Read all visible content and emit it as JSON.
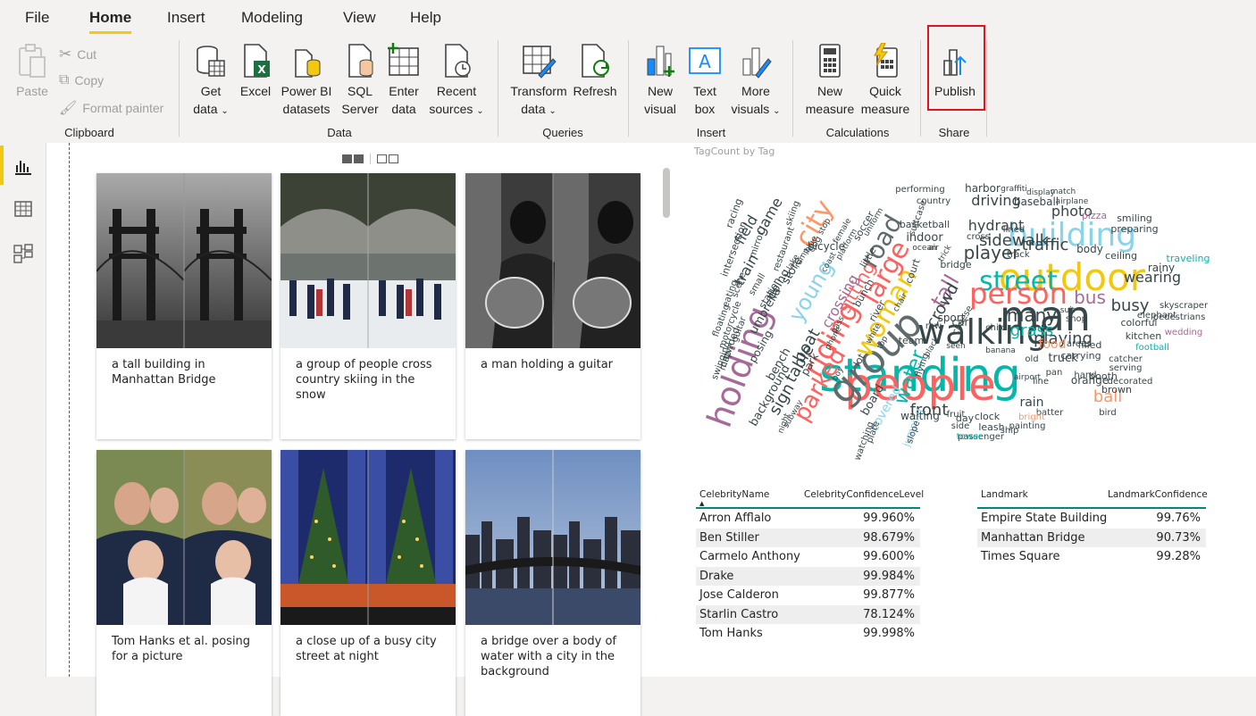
{
  "ribbon": {
    "tabs": [
      "File",
      "Home",
      "Insert",
      "Modeling",
      "View",
      "Help"
    ],
    "clipboard": {
      "paste": "Paste",
      "cut": "Cut",
      "copy": "Copy",
      "format_painter": "Format painter",
      "group": "Clipboard"
    },
    "data": {
      "get_data": [
        "Get",
        "data"
      ],
      "excel": "Excel",
      "pbi": [
        "Power BI",
        "datasets"
      ],
      "sql": [
        "SQL",
        "Server"
      ],
      "enter": [
        "Enter",
        "data"
      ],
      "recent": [
        "Recent",
        "sources"
      ],
      "group": "Data"
    },
    "queries": {
      "transform": [
        "Transform",
        "data"
      ],
      "refresh": "Refresh",
      "group": "Queries"
    },
    "insert": {
      "new_visual": [
        "New",
        "visual"
      ],
      "text_box": [
        "Text",
        "box"
      ],
      "more": [
        "More",
        "visuals"
      ],
      "group": "Insert"
    },
    "calculations": {
      "new_measure": [
        "New",
        "measure"
      ],
      "quick_measure": [
        "Quick",
        "measure"
      ],
      "group": "Calculations"
    },
    "share": {
      "publish": "Publish",
      "group": "Share"
    }
  },
  "gallery": {
    "cards": [
      {
        "caption": "a tall building in Manhattan Bridge",
        "image": "bridge-photo"
      },
      {
        "caption": "a group of people cross country skiing in the snow",
        "image": "skating-photo"
      },
      {
        "caption": "a man holding a guitar",
        "image": "guitar-photo"
      },
      {
        "caption": "Tom Hanks et al. posing for a picture",
        "image": "people-photo"
      },
      {
        "caption": "a close up of a busy city street at night",
        "image": "tree-photo"
      },
      {
        "caption": "a bridge over a body of water with a city in the background",
        "image": "skyline-photo"
      }
    ]
  },
  "wordcloud": {
    "title": "TagCount by Tag",
    "words": [
      {
        "t": "standing",
        "c": "#01b8aa"
      },
      {
        "t": "people",
        "c": "#fd625e"
      },
      {
        "t": "man",
        "c": "#374649"
      },
      {
        "t": "outdoor",
        "c": "#f2c80f"
      },
      {
        "t": "group",
        "c": "#5f6b6d"
      },
      {
        "t": "building",
        "c": "#8ad4eb"
      },
      {
        "t": "holding",
        "c": "#a66999"
      },
      {
        "t": "walking",
        "c": "#374649"
      },
      {
        "t": "street",
        "c": "#01b8aa"
      },
      {
        "t": "person",
        "c": "#fd625e"
      },
      {
        "t": "riding",
        "c": "#fd625e"
      },
      {
        "t": "city",
        "c": "#fe9666"
      },
      {
        "t": "woman",
        "c": "#f2c80f"
      },
      {
        "t": "large",
        "c": "#fd625e"
      },
      {
        "t": "road",
        "c": "#5f6b6d"
      },
      {
        "t": "parked",
        "c": "#fd625e"
      },
      {
        "t": "front",
        "c": "#374649"
      },
      {
        "t": "water",
        "c": "#01b8aa"
      },
      {
        "t": "player",
        "c": "#374649"
      },
      {
        "t": "sidewalk",
        "c": "#374649"
      },
      {
        "t": "traffic",
        "c": "#374649"
      },
      {
        "t": "bus",
        "c": "#a66999"
      },
      {
        "t": "busy",
        "c": "#374649"
      },
      {
        "t": "many",
        "c": "#374649"
      },
      {
        "t": "grass",
        "c": "#01b8aa"
      },
      {
        "t": "playing",
        "c": "#374649"
      },
      {
        "t": "ball",
        "c": "#fe9666"
      },
      {
        "t": "wearing",
        "c": "#374649"
      },
      {
        "t": "young",
        "c": "#8ad4eb"
      },
      {
        "t": "tall",
        "c": "#a66999"
      },
      {
        "t": "crowd",
        "c": "#374649"
      },
      {
        "t": "sitting",
        "c": "#fd625e"
      },
      {
        "t": "table",
        "c": "#374649"
      },
      {
        "t": "boat",
        "c": "#374649"
      },
      {
        "t": "sign",
        "c": "#374649"
      },
      {
        "t": "photo",
        "c": "#374649"
      },
      {
        "t": "driving",
        "c": "#374649"
      },
      {
        "t": "hydrant",
        "c": "#374649"
      },
      {
        "t": "baseball",
        "c": "#374649"
      },
      {
        "t": "crossing",
        "c": "#a66999"
      },
      {
        "t": "food",
        "c": "#fe9666"
      },
      {
        "t": "train",
        "c": "#374649"
      },
      {
        "t": "field",
        "c": "#374649"
      },
      {
        "t": "game",
        "c": "#374649"
      },
      {
        "t": "body",
        "c": "#374649"
      },
      {
        "t": "ceiling",
        "c": "#374649"
      },
      {
        "t": "pizza",
        "c": "#a66999"
      },
      {
        "t": "smiling",
        "c": "#374649"
      },
      {
        "t": "preparing",
        "c": "#374649"
      },
      {
        "t": "traveling",
        "c": "#01b8aa"
      },
      {
        "t": "rainy",
        "c": "#374649"
      },
      {
        "t": "skyscraper",
        "c": "#374649"
      },
      {
        "t": "pedestrians",
        "c": "#374649"
      },
      {
        "t": "elephant",
        "c": "#374649"
      },
      {
        "t": "wedding",
        "c": "#a66999"
      },
      {
        "t": "colorful",
        "c": "#374649"
      },
      {
        "t": "kitchen",
        "c": "#374649"
      },
      {
        "t": "football",
        "c": "#01b8aa"
      },
      {
        "t": "catcher",
        "c": "#374649"
      },
      {
        "t": "serving",
        "c": "#374649"
      },
      {
        "t": "decorated",
        "c": "#374649"
      },
      {
        "t": "booth",
        "c": "#374649"
      },
      {
        "t": "orange",
        "c": "#374649"
      },
      {
        "t": "brown",
        "c": "#374649"
      },
      {
        "t": "bird",
        "c": "#374649"
      },
      {
        "t": "rain",
        "c": "#374649"
      },
      {
        "t": "batter",
        "c": "#374649"
      },
      {
        "t": "bright",
        "c": "#fe9666"
      },
      {
        "t": "clock",
        "c": "#374649"
      },
      {
        "t": "leash",
        "c": "#374649"
      },
      {
        "t": "day",
        "c": "#374649"
      },
      {
        "t": "passenger",
        "c": "#374649"
      },
      {
        "t": "painting",
        "c": "#374649"
      },
      {
        "t": "ship",
        "c": "#374649"
      },
      {
        "t": "tower",
        "c": "#01b8aa"
      },
      {
        "t": "side",
        "c": "#374649"
      },
      {
        "t": "fruit",
        "c": "#374649"
      },
      {
        "t": "jumping",
        "c": "#8ad4eb"
      },
      {
        "t": "waiting",
        "c": "#374649"
      },
      {
        "t": "covered",
        "c": "#8ad4eb"
      },
      {
        "t": "slope",
        "c": "#374649"
      },
      {
        "t": "plate",
        "c": "#374649"
      },
      {
        "t": "watching",
        "c": "#374649"
      },
      {
        "t": "board",
        "c": "#374649"
      },
      {
        "t": "bench",
        "c": "#374649"
      },
      {
        "t": "park",
        "c": "#374649"
      },
      {
        "t": "store",
        "c": "#374649"
      },
      {
        "t": "umbrella",
        "c": "#374649"
      },
      {
        "t": "doing",
        "c": "#374649"
      },
      {
        "t": "posing",
        "c": "#374649"
      },
      {
        "t": "background",
        "c": "#374649"
      },
      {
        "t": "station",
        "c": "#374649"
      },
      {
        "t": "small",
        "c": "#374649"
      },
      {
        "t": "crowded",
        "c": "#374649"
      },
      {
        "t": "eating",
        "c": "#374649"
      },
      {
        "t": "map",
        "c": "#374649"
      },
      {
        "t": "floating",
        "c": "#374649"
      },
      {
        "t": "swinging",
        "c": "#374649"
      },
      {
        "t": "motorcycle",
        "c": "#374649"
      },
      {
        "t": "guitar",
        "c": "#374649"
      },
      {
        "t": "scene",
        "c": "#374649"
      },
      {
        "t": "intersection",
        "c": "#374649"
      },
      {
        "t": "racing",
        "c": "#374649"
      },
      {
        "t": "mirror",
        "c": "#374649"
      },
      {
        "t": "restaurant",
        "c": "#374649"
      },
      {
        "t": "skiing",
        "c": "#374649"
      },
      {
        "t": "bicycle",
        "c": "#374649"
      },
      {
        "t": "dog",
        "c": "#374649"
      },
      {
        "t": "stop",
        "c": "#374649"
      },
      {
        "t": "female",
        "c": "#374649"
      },
      {
        "t": "soccer",
        "c": "#374649"
      },
      {
        "t": "uniform",
        "c": "#374649"
      },
      {
        "t": "suitcase",
        "c": "#374649"
      },
      {
        "t": "performing",
        "c": "#374649"
      },
      {
        "t": "country",
        "c": "#374649"
      },
      {
        "t": "harbor",
        "c": "#374649"
      },
      {
        "t": "graffiti",
        "c": "#374649"
      },
      {
        "t": "display",
        "c": "#374649"
      },
      {
        "t": "match",
        "c": "#374649"
      },
      {
        "t": "airplane",
        "c": "#374649"
      },
      {
        "t": "basketball",
        "c": "#374649"
      },
      {
        "t": "indoor",
        "c": "#374649"
      },
      {
        "t": "ocean",
        "c": "#374649"
      },
      {
        "t": "air",
        "c": "#374649"
      },
      {
        "t": "cross",
        "c": "#374649"
      },
      {
        "t": "lined",
        "c": "#374649"
      },
      {
        "t": "track",
        "c": "#374649"
      },
      {
        "t": "court",
        "c": "#374649"
      },
      {
        "t": "bridge",
        "c": "#374649"
      },
      {
        "t": "sport",
        "c": "#374649"
      },
      {
        "t": "car",
        "c": "#374649"
      },
      {
        "t": "child",
        "c": "#374649"
      },
      {
        "t": "cheese",
        "c": "#374649"
      },
      {
        "t": "row",
        "c": "#374649"
      },
      {
        "t": "shop",
        "c": "#374649"
      },
      {
        "t": "suit",
        "c": "#374649"
      },
      {
        "t": "filled",
        "c": "#374649"
      },
      {
        "t": "area",
        "c": "#374649"
      },
      {
        "t": "truck",
        "c": "#374649"
      },
      {
        "t": "carrying",
        "c": "#374649"
      },
      {
        "t": "hand",
        "c": "#374649"
      },
      {
        "t": "old",
        "c": "#374649"
      },
      {
        "t": "banana",
        "c": "#374649"
      },
      {
        "t": "seen",
        "c": "#374649"
      },
      {
        "t": "flying",
        "c": "#374649"
      },
      {
        "t": "team",
        "c": "#374649"
      },
      {
        "t": "lot",
        "c": "#374649"
      },
      {
        "t": "bunch",
        "c": "#374649"
      },
      {
        "t": "river",
        "c": "#374649"
      },
      {
        "t": "little",
        "c": "#374649"
      },
      {
        "t": "night",
        "c": "#374649"
      },
      {
        "t": "subway",
        "c": "#374649"
      },
      {
        "t": "airport",
        "c": "#374649"
      },
      {
        "t": "pan",
        "c": "#374649"
      },
      {
        "t": "line",
        "c": "#374649"
      },
      {
        "t": "lake",
        "c": "#374649"
      },
      {
        "t": "ramp",
        "c": "#374649"
      },
      {
        "t": "blue",
        "c": "#374649"
      },
      {
        "t": "phone",
        "c": "#374649"
      },
      {
        "t": "white",
        "c": "#374649"
      },
      {
        "t": "trick",
        "c": "#374649"
      },
      {
        "t": "top",
        "c": "#374649"
      },
      {
        "t": "black",
        "c": "#374649"
      },
      {
        "t": "pass",
        "c": "#374649"
      },
      {
        "t": "coast",
        "c": "#374649"
      },
      {
        "t": "platform",
        "c": "#374649"
      },
      {
        "t": "chair",
        "c": "#374649"
      },
      {
        "t": "boy",
        "c": "#374649"
      }
    ]
  },
  "celebrity_table": {
    "headers": [
      "CelebrityName",
      "CelebrityConfidenceLevel"
    ],
    "rows": [
      [
        "Arron Afflalo",
        "99.960%"
      ],
      [
        "Ben Stiller",
        "98.679%"
      ],
      [
        "Carmelo Anthony",
        "99.600%"
      ],
      [
        "Drake",
        "99.984%"
      ],
      [
        "Jose Calderon",
        "99.877%"
      ],
      [
        "Starlin Castro",
        "78.124%"
      ],
      [
        "Tom Hanks",
        "99.998%"
      ]
    ]
  },
  "landmark_table": {
    "headers": [
      "Landmark",
      "LandmarkConfidence"
    ],
    "rows": [
      [
        "Empire State Building",
        "99.76%"
      ],
      [
        "Manhattan Bridge",
        "90.73%"
      ],
      [
        "Times Square",
        "99.28%"
      ]
    ]
  },
  "colors": {
    "accent": "#f2c811",
    "highlight": "#e0141e",
    "header_line": "#118dff"
  }
}
